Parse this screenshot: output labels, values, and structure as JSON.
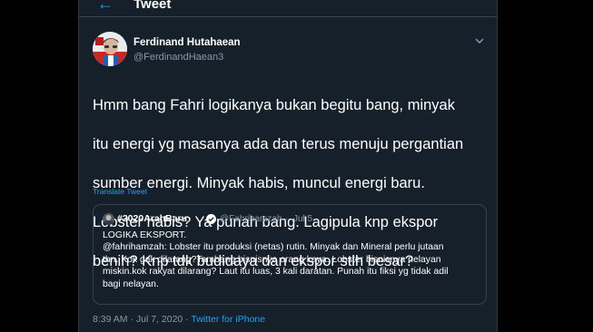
{
  "header": {
    "title": "Tweet",
    "back_icon": "arrow-left-icon"
  },
  "author": {
    "name": "Ferdinand Hutahaean",
    "handle": "@FerdinandHaean3"
  },
  "tweet": {
    "lines": [
      "Hmm bang Fahri logikanya bukan begitu bang, minyak",
      "itu energi yg masanya ada dan terus menuju pergantian",
      "sumber energi. Minyak habis, muncul energi baru.",
      "Lobster habis? Ya punah bang. Lagipula knp ekspor",
      "benih? Knp tdk budidaya dan ekspor stlh besar?"
    ],
    "translate_label": "Translate Tweet"
  },
  "quote": {
    "name": "#2020ArahBaru",
    "handle": "@Fahrihamzah",
    "separator": "·",
    "date": "Jul 5",
    "lines": [
      "LOGIKA EKSPORT.",
      "@fahrihamzah: Lobster itu produksi (netas) rutin. Minyak dan Mineral perlu jutaan",
      "thn. Kok gak dilarang?Tambang bisnisnya orang kaya. Lobster bisnisnya nelayan",
      "miskin.kok rakyat dilarang? Laut itu luas, 3 kali daratan. Punah itu fiksi yg tidak adil",
      "bagi nelayan."
    ]
  },
  "meta": {
    "time": "8:39 AM",
    "sep": " · ",
    "date": "Jul 7, 2020",
    "source": "Twitter for iPhone"
  },
  "colors": {
    "background": "#15202b",
    "accent": "#1da1f2",
    "secondary_text": "#8899a6",
    "border": "#38444d"
  }
}
